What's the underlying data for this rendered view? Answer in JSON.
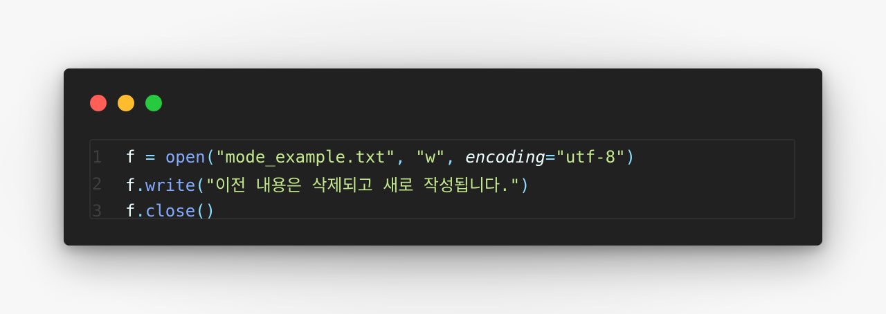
{
  "colors": {
    "window_bg": "#212121",
    "close": "#ff5f56",
    "minimize": "#ffbd2e",
    "maximize": "#27c93f"
  },
  "code": {
    "lines": [
      {
        "number": "1",
        "tokens": [
          {
            "text": "f",
            "kind": "ident"
          },
          {
            "text": " ",
            "kind": "ident"
          },
          {
            "text": "=",
            "kind": "op"
          },
          {
            "text": " ",
            "kind": "ident"
          },
          {
            "text": "open",
            "kind": "func"
          },
          {
            "text": "(",
            "kind": "op"
          },
          {
            "text": "\"mode_example.txt\"",
            "kind": "str"
          },
          {
            "text": ", ",
            "kind": "op"
          },
          {
            "text": "\"w\"",
            "kind": "str"
          },
          {
            "text": ", ",
            "kind": "op"
          },
          {
            "text": "encoding",
            "kind": "param"
          },
          {
            "text": "=",
            "kind": "op"
          },
          {
            "text": "\"utf-8\"",
            "kind": "str"
          },
          {
            "text": ")",
            "kind": "op"
          }
        ]
      },
      {
        "number": "2",
        "tokens": [
          {
            "text": "f",
            "kind": "ident"
          },
          {
            "text": ".",
            "kind": "op"
          },
          {
            "text": "write",
            "kind": "func"
          },
          {
            "text": "(",
            "kind": "op"
          },
          {
            "text": "\"이전 내용은 삭제되고 새로 작성됩니다.\"",
            "kind": "str"
          },
          {
            "text": ")",
            "kind": "op"
          }
        ]
      },
      {
        "number": "3",
        "tokens": [
          {
            "text": "f",
            "kind": "ident"
          },
          {
            "text": ".",
            "kind": "op"
          },
          {
            "text": "close",
            "kind": "func"
          },
          {
            "text": "()",
            "kind": "op"
          }
        ]
      }
    ]
  }
}
